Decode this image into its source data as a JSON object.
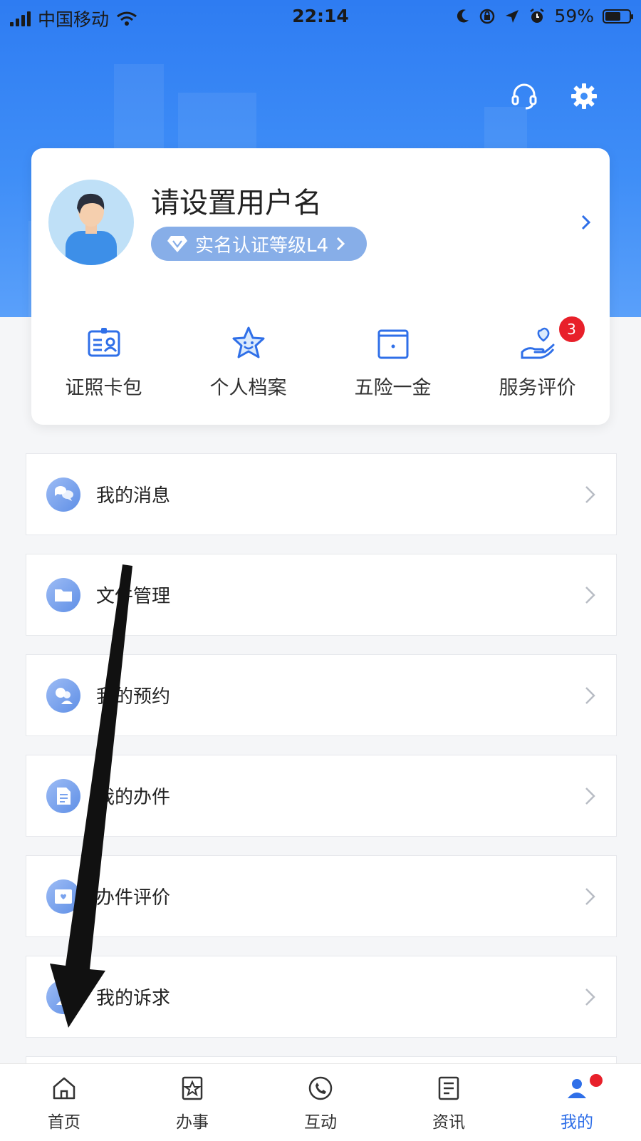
{
  "status": {
    "carrier": "中国移动",
    "time": "22:14",
    "battery": "59%",
    "battery_level": 0.59
  },
  "header": {
    "support_icon": "headset-icon",
    "settings_icon": "gear-icon"
  },
  "profile": {
    "username": "请设置用户名",
    "cert_label": "实名认证等级L4"
  },
  "quick_actions": [
    {
      "label": "证照卡包",
      "icon": "id-card-icon"
    },
    {
      "label": "个人档案",
      "icon": "star-face-icon"
    },
    {
      "label": "五险一金",
      "icon": "wallet-icon"
    },
    {
      "label": "服务评价",
      "icon": "hand-heart-icon",
      "badge": "3"
    }
  ],
  "menu": [
    {
      "label": "我的消息",
      "icon": "message-icon"
    },
    {
      "label": "文件管理",
      "icon": "folder-icon"
    },
    {
      "label": "我的预约",
      "icon": "appointment-icon"
    },
    {
      "label": "我的办件",
      "icon": "document-icon"
    },
    {
      "label": "办件评价",
      "icon": "rating-icon"
    },
    {
      "label": "我的诉求",
      "icon": "appeal-icon"
    }
  ],
  "tabs": [
    {
      "label": "首页",
      "icon": "home-icon"
    },
    {
      "label": "办事",
      "icon": "service-icon"
    },
    {
      "label": "互动",
      "icon": "phone-12345-icon"
    },
    {
      "label": "资讯",
      "icon": "news-icon"
    },
    {
      "label": "我的",
      "icon": "user-icon",
      "active": true
    }
  ],
  "colors": {
    "primary": "#2f6fe8",
    "badge": "#e8202a",
    "hero": "#3f8ef7"
  }
}
